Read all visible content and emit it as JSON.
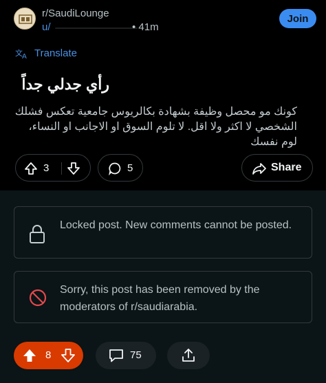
{
  "post": {
    "subreddit": "r/SaudiLounge",
    "user_prefix": "u/",
    "time": "• 41m",
    "join_label": "Join",
    "translate_label": "Translate",
    "title": "رأي جدلي جداً",
    "body": "كونك مو محصل وظيفة بشهادة بكالريوس جامعية تعكس فشلك الشخصي لا اكثر ولا اقل. لا تلوم السوق او الاجانب او النساء، لوم نفسك",
    "votes": "3",
    "comments": "5",
    "share_label": "Share"
  },
  "notices": {
    "locked": "Locked post. New comments cannot be posted.",
    "removed": "Sorry, this post has been removed by the moderators of r/saudiarabia."
  },
  "bottom_bar": {
    "votes": "8",
    "comments": "75"
  },
  "colors": {
    "background": "#0b1416",
    "post_background": "#000000",
    "accent_blue": "#3b8cf0",
    "upvoted_orange": "#d93a00"
  },
  "icons": [
    "translate-icon",
    "upvote-icon",
    "downvote-icon",
    "comment-icon",
    "share-icon",
    "lock-icon",
    "removed-icon",
    "upload-icon"
  ]
}
